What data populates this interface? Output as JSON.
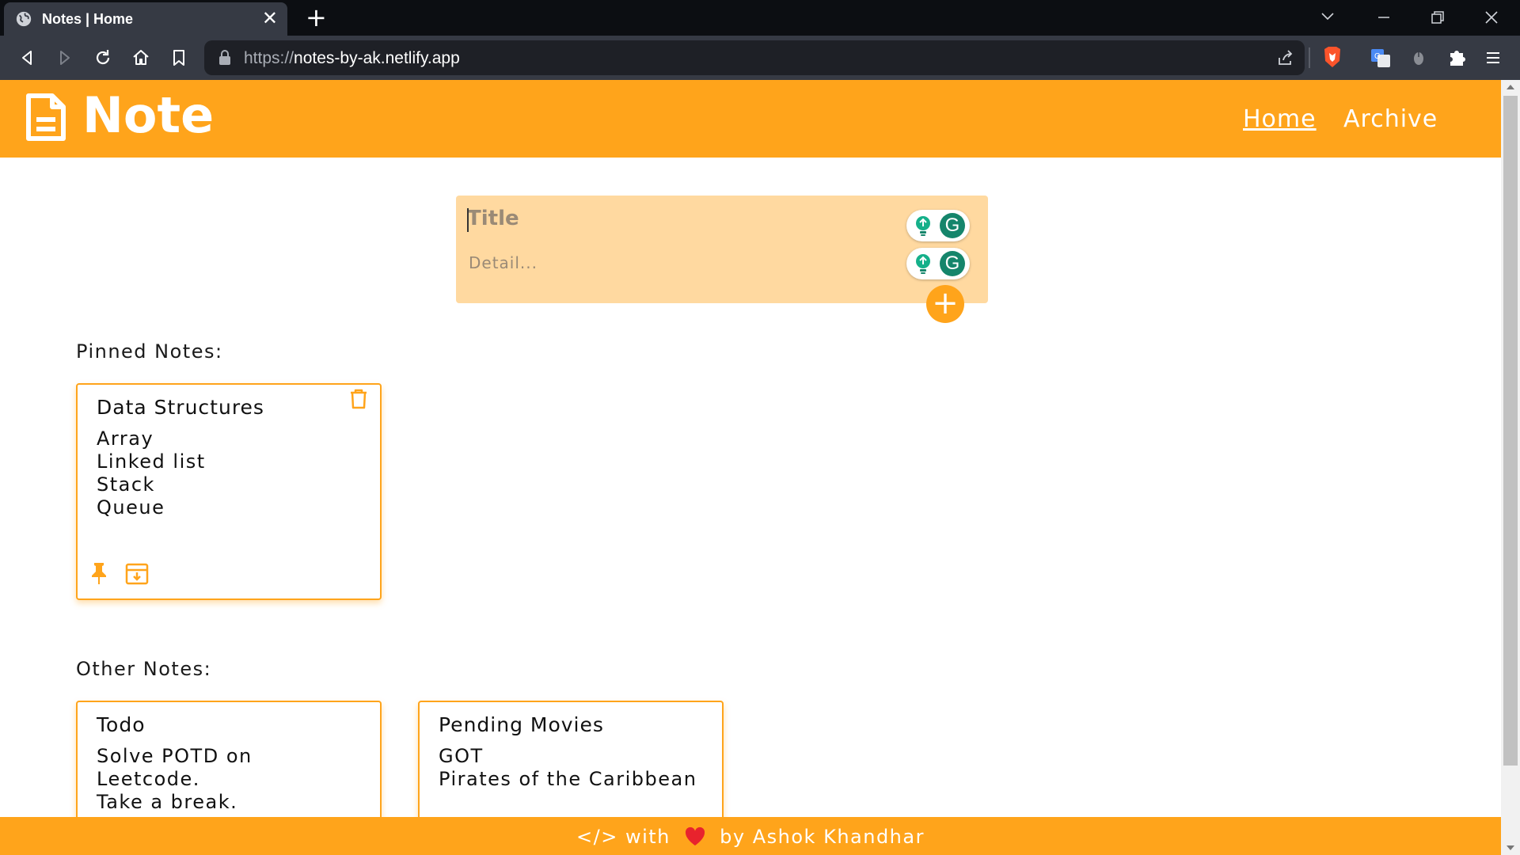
{
  "browser": {
    "tab_title": "Notes | Home",
    "tab_close": "✕",
    "new_tab": "+",
    "url_protocol": "https://",
    "url_host": "notes-by-ak.netlify.app"
  },
  "header": {
    "logo_text": "Note",
    "nav": {
      "home": "Home",
      "archive": "Archive"
    }
  },
  "composer": {
    "title_placeholder": "Title",
    "detail_placeholder": "Detail...",
    "add_label": "+"
  },
  "pinned": {
    "label": "Pinned Notes:",
    "notes": [
      {
        "title": "Data Structures",
        "lines": [
          "Array",
          "Linked list",
          "Stack",
          "Queue"
        ]
      }
    ]
  },
  "other": {
    "label": "Other Notes:",
    "notes": [
      {
        "title": "Todo",
        "lines": [
          "Solve POTD on",
          "Leetcode.",
          "Take a break."
        ]
      },
      {
        "title": "Pending Movies",
        "lines": [
          "GOT",
          "Pirates of the Caribbean"
        ]
      }
    ]
  },
  "footer": {
    "prefix": "</> with",
    "suffix": "by Ashok Khandhar"
  },
  "colors": {
    "accent": "#ffa41b",
    "composer_bg": "#ffd9a0",
    "chrome_dark": "#0c0e12",
    "chrome_toolbar": "#363a44"
  }
}
